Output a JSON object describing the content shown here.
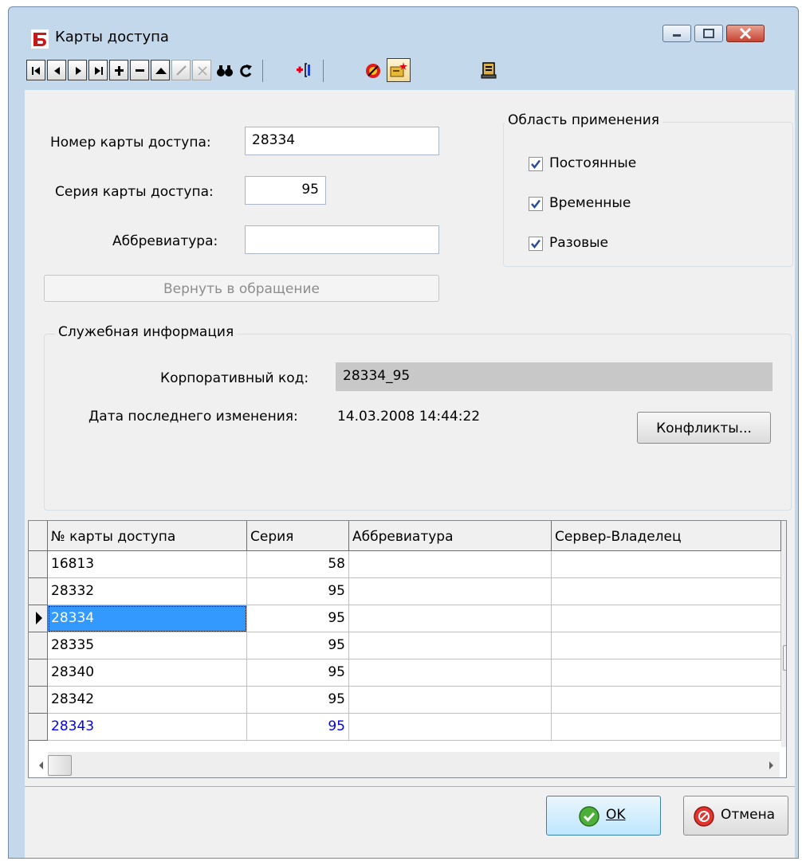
{
  "window": {
    "title": "Карты доступа",
    "colors": {
      "frame": "#c4d8ec",
      "client": "#f0f0f0",
      "selection": "#3399ff",
      "highlight_row_text": "#0000ff"
    }
  },
  "toolbar": {
    "icons": [
      "first-record-icon",
      "prev-record-icon",
      "next-record-icon",
      "last-record-icon",
      "add-record-icon",
      "delete-record-icon",
      "edit-up-icon",
      "post-edit-icon",
      "cancel-edit-icon",
      "binoculars-icon",
      "refresh-icon",
      "insert-field-icon",
      "stop-icon",
      "card-new-icon",
      "server-icon"
    ]
  },
  "form": {
    "card_number_label": "Номер карты доступа:",
    "card_number_value": "28334",
    "card_series_label": "Серия карты доступа:",
    "card_series_value": "95",
    "abbr_label": "Аббревиатура:",
    "abbr_value": "",
    "return_button": "Вернуть в обращение"
  },
  "scope": {
    "title": "Область применения",
    "items": [
      {
        "label": "Постоянные",
        "checked": true
      },
      {
        "label": "Временные",
        "checked": true
      },
      {
        "label": "Разовые",
        "checked": true
      }
    ]
  },
  "service": {
    "title": "Служебная информация",
    "corp_code_label": "Корпоративный код:",
    "corp_code_value": "28334_95",
    "last_change_label": "Дата последнего изменения:",
    "last_change_value": "14.03.2008 14:44:22",
    "conflicts_button": "Конфликты..."
  },
  "grid": {
    "columns": [
      "№ карты доступа",
      "Серия",
      "Аббревиатура",
      "Сервер-Владелец"
    ],
    "rows": [
      {
        "number": "16813",
        "series": "58",
        "abbr": "",
        "owner": ""
      },
      {
        "number": "28332",
        "series": "95",
        "abbr": "",
        "owner": ""
      },
      {
        "number": "28334",
        "series": "95",
        "abbr": "",
        "owner": "",
        "current": true
      },
      {
        "number": "28335",
        "series": "95",
        "abbr": "",
        "owner": ""
      },
      {
        "number": "28340",
        "series": "95",
        "abbr": "",
        "owner": ""
      },
      {
        "number": "28342",
        "series": "95",
        "abbr": "",
        "owner": ""
      },
      {
        "number": "28343",
        "series": "95",
        "abbr": "",
        "owner": "",
        "highlight": true
      }
    ]
  },
  "footer": {
    "ok_label": "OK",
    "cancel_label": "Отмена"
  }
}
